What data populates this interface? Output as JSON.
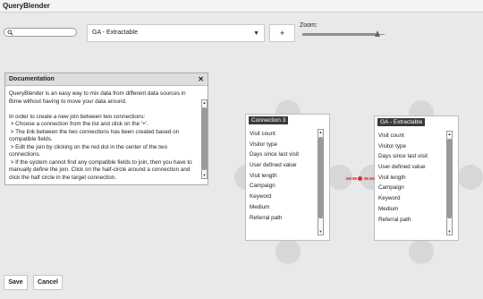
{
  "app": {
    "title": "QueryBlender"
  },
  "search": {
    "value": "",
    "placeholder": ""
  },
  "source_select": {
    "selected": "GA - Extractable",
    "arrow": "▼"
  },
  "plus_button": {
    "label": "+"
  },
  "zoom": {
    "label": "Zoom:",
    "level": 0.91
  },
  "documentation": {
    "title": "Documentation",
    "close": "✕",
    "lines": [
      "QueryBlender is an easy way to mix data from different data sources in Bime without having to move your data around.",
      "",
      "In order to create a new join between two connections:",
      " > Choose a connection from the list and click on the '+'.",
      " > The link between the two connections has been created based on compatible fields.",
      " > Edit the join by clicking on the red dot in the center of the two connections.",
      " > If the system cannot find any compatible fields to join, then you have to manually define the join. Click on the half-circle around a connection and click the half circle in the target connection."
    ]
  },
  "connection_left": {
    "title": "Connection 3",
    "fields": [
      "Visit count",
      "Visitor type",
      "Days since last visit",
      "User defined value",
      "Visit length",
      "Campaign",
      "Keyword",
      "Medium",
      "Referral path"
    ]
  },
  "connection_right": {
    "title": "GA - Extractable",
    "fields": [
      "Visit count",
      "Visitor type",
      "Days since last visit",
      "User defined value",
      "Visit length",
      "Campaign",
      "Keyword",
      "Medium",
      "Referral path"
    ]
  },
  "footer": {
    "save_label": "Save",
    "cancel_label": "Cancel"
  },
  "colors": {
    "join_dot": "#d43030",
    "join_line": "#e87070",
    "header_bg": "#3a3a3a"
  },
  "icons": {
    "search": "search-icon",
    "close": "close-icon",
    "dropdown": "chevron-down-icon"
  }
}
